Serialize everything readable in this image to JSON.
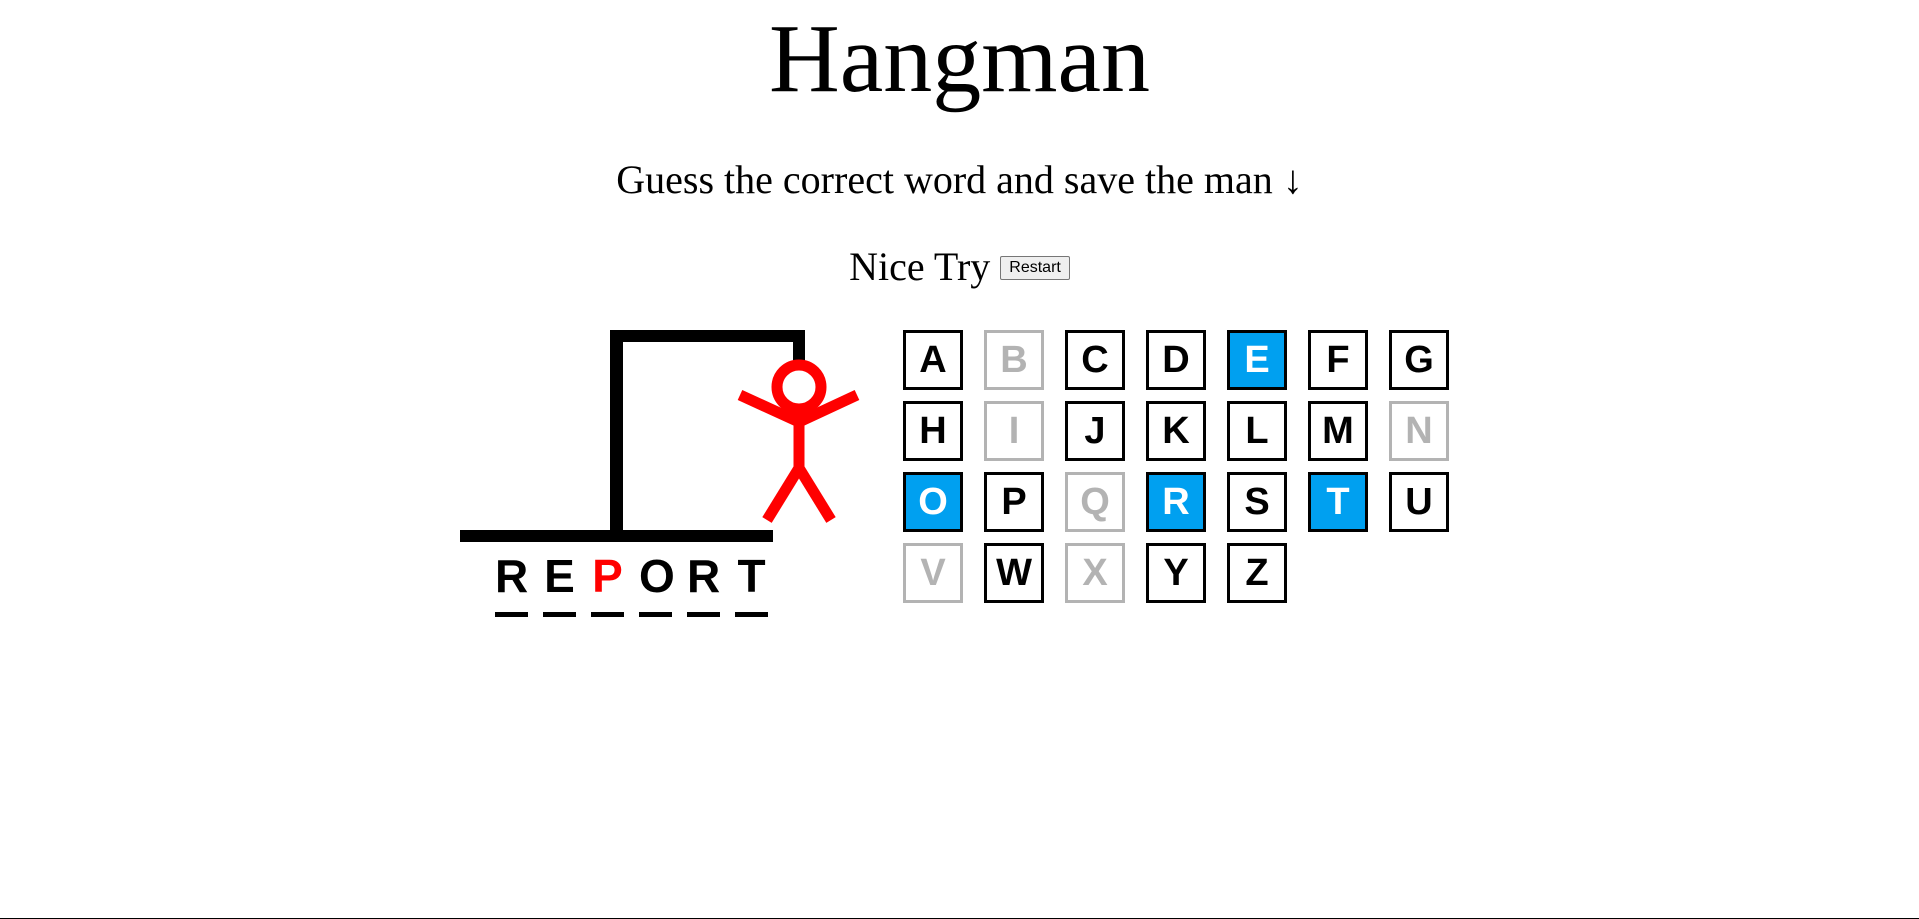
{
  "header": {
    "title": "Hangman",
    "subtitle": "Guess the correct word and save the man ↓"
  },
  "status": {
    "message": "Nice Try",
    "restart_label": "Restart"
  },
  "colors": {
    "gallows": "#000000",
    "man": "#ff0000",
    "correct_key_bg": "#00a0f0",
    "used_key": "#b3b3b3",
    "missed_letter": "#ff0000"
  },
  "word": {
    "letters": [
      {
        "char": "R",
        "state": "revealed"
      },
      {
        "char": "E",
        "state": "revealed"
      },
      {
        "char": "P",
        "state": "missed"
      },
      {
        "char": "O",
        "state": "revealed"
      },
      {
        "char": "R",
        "state": "revealed"
      },
      {
        "char": "T",
        "state": "revealed"
      }
    ]
  },
  "keyboard": {
    "keys": [
      {
        "letter": "A",
        "state": "available"
      },
      {
        "letter": "B",
        "state": "used"
      },
      {
        "letter": "C",
        "state": "available"
      },
      {
        "letter": "D",
        "state": "available"
      },
      {
        "letter": "E",
        "state": "correct"
      },
      {
        "letter": "F",
        "state": "available"
      },
      {
        "letter": "G",
        "state": "available"
      },
      {
        "letter": "H",
        "state": "available"
      },
      {
        "letter": "I",
        "state": "used"
      },
      {
        "letter": "J",
        "state": "available"
      },
      {
        "letter": "K",
        "state": "available"
      },
      {
        "letter": "L",
        "state": "available"
      },
      {
        "letter": "M",
        "state": "available"
      },
      {
        "letter": "N",
        "state": "used"
      },
      {
        "letter": "O",
        "state": "correct"
      },
      {
        "letter": "P",
        "state": "available"
      },
      {
        "letter": "Q",
        "state": "used"
      },
      {
        "letter": "R",
        "state": "correct"
      },
      {
        "letter": "S",
        "state": "available"
      },
      {
        "letter": "T",
        "state": "correct"
      },
      {
        "letter": "U",
        "state": "available"
      },
      {
        "letter": "V",
        "state": "used"
      },
      {
        "letter": "W",
        "state": "available"
      },
      {
        "letter": "X",
        "state": "used"
      },
      {
        "letter": "Y",
        "state": "available"
      },
      {
        "letter": "Z",
        "state": "available"
      }
    ]
  }
}
